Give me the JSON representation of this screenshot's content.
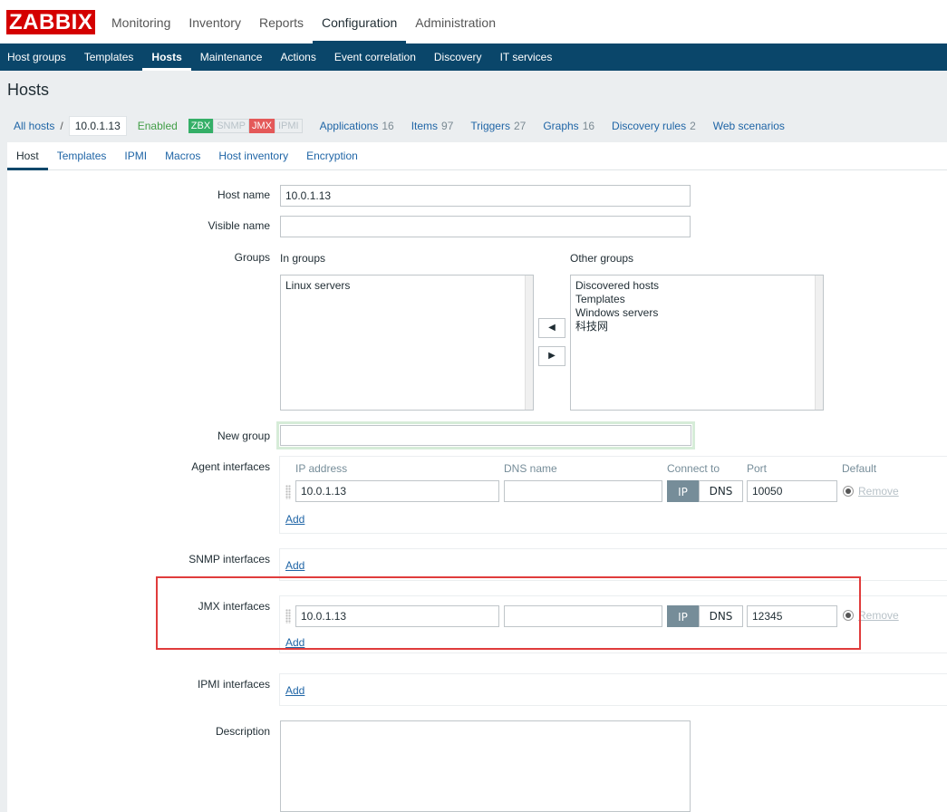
{
  "top_menu": {
    "logo": "ZABBIX",
    "items": [
      "Monitoring",
      "Inventory",
      "Reports",
      "Configuration",
      "Administration"
    ]
  },
  "sub_menu": {
    "items": [
      "Host groups",
      "Templates",
      "Hosts",
      "Maintenance",
      "Actions",
      "Event correlation",
      "Discovery",
      "IT services"
    ]
  },
  "page": {
    "title": "Hosts"
  },
  "breadcrumb": {
    "all_hosts": "All hosts",
    "separator": "/",
    "current": "10.0.1.13",
    "status": "Enabled",
    "badges": {
      "zbx": "ZBX",
      "snmp": "SNMP",
      "jmx": "JMX",
      "ipmi": "IPMI"
    },
    "links": [
      {
        "label": "Applications",
        "count": "16"
      },
      {
        "label": "Items",
        "count": "97"
      },
      {
        "label": "Triggers",
        "count": "27"
      },
      {
        "label": "Graphs",
        "count": "16"
      },
      {
        "label": "Discovery rules",
        "count": "2"
      },
      {
        "label": "Web scenarios",
        "count": ""
      }
    ]
  },
  "tabs": [
    "Host",
    "Templates",
    "IPMI",
    "Macros",
    "Host inventory",
    "Encryption"
  ],
  "form": {
    "host_name": {
      "label": "Host name",
      "value": "10.0.1.13"
    },
    "visible_name": {
      "label": "Visible name",
      "value": ""
    },
    "groups": {
      "label": "Groups",
      "in_groups_label": "In groups",
      "in_groups": [
        "Linux servers"
      ],
      "other_groups_label": "Other groups",
      "other_groups": [
        "Discovered hosts",
        "Templates",
        "Windows servers",
        "科技网"
      ]
    },
    "new_group": {
      "label": "New group",
      "value": ""
    },
    "agent_interfaces": {
      "label": "Agent interfaces",
      "headers": {
        "ip": "IP address",
        "dns": "DNS name",
        "connect": "Connect to",
        "port": "Port",
        "default": "Default"
      },
      "ip": "10.0.1.13",
      "dns": "",
      "connect_ip": "IP",
      "connect_dns": "DNS",
      "port": "10050",
      "remove": "Remove",
      "add": "Add"
    },
    "snmp_interfaces": {
      "label": "SNMP interfaces",
      "add": "Add"
    },
    "jmx_interfaces": {
      "label": "JMX interfaces",
      "ip": "10.0.1.13",
      "dns": "",
      "connect_ip": "IP",
      "connect_dns": "DNS",
      "port": "12345",
      "remove": "Remove",
      "add": "Add"
    },
    "ipmi_interfaces": {
      "label": "IPMI interfaces",
      "add": "Add"
    },
    "description": {
      "label": "Description",
      "value": ""
    }
  },
  "colors": {
    "brand": "#d40000",
    "nav": "#0a466a",
    "highlight": "#e03c3c",
    "link": "#1f65a6"
  }
}
